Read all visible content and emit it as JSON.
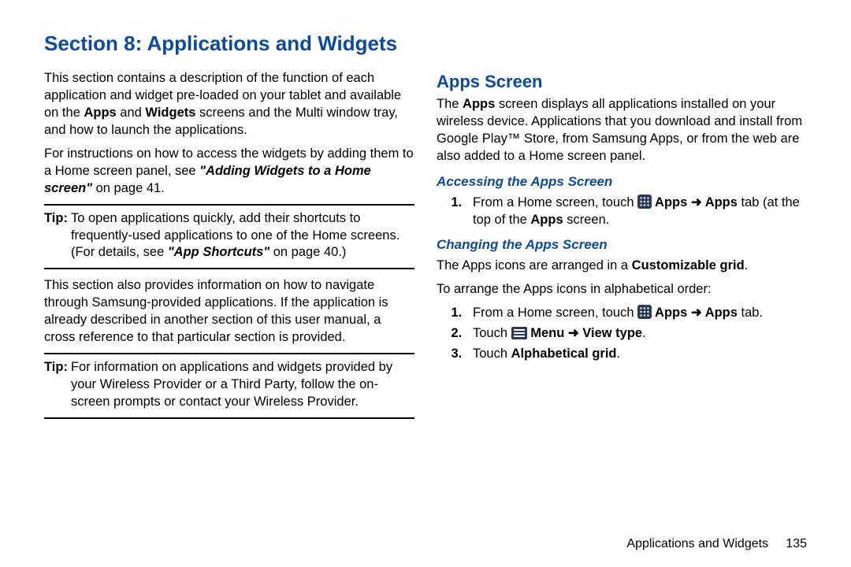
{
  "title": "Section 8: Applications and Widgets",
  "left": {
    "p1a": "This section contains a description of the function of each application and widget pre-loaded on your tablet and available on the ",
    "p1b_bold": "Apps",
    "p1c": " and ",
    "p1d_bold": "Widgets",
    "p1e": " screens and the Multi window tray, and how to launch the applications.",
    "p2a": "For instructions on how to access the widgets by adding them to a Home screen panel, see ",
    "p2b_link": "\"Adding Widgets to a Home screen\"",
    "p2c": " on page 41.",
    "tip1_label": "Tip:",
    "tip1a": " To open applications quickly, add their shortcuts to frequently-used applications to one of the Home screens. (For details, see ",
    "tip1b_link": "\"App Shortcuts\"",
    "tip1c": " on page 40.)",
    "p3": "This section also provides information on how to navigate through Samsung-provided applications. If the application is already described in another section of this user manual, a cross reference to that particular section is provided.",
    "tip2_label": "Tip:",
    "tip2": " For information on applications and widgets provided by your Wireless Provider or a Third Party, follow the on-screen prompts or contact your Wireless Provider."
  },
  "right": {
    "h2": "Apps Screen",
    "intro_a": "The ",
    "intro_b_bold": "Apps",
    "intro_c": " screen displays all applications installed on your wireless device. Applications that you download and install from Google Play™ Store, from Samsung Apps, or from the web are also added to a Home screen panel.",
    "h3a": "Accessing the Apps Screen",
    "a1_pre": "From a Home screen, touch ",
    "a1_apps": " Apps ",
    "a1_apps_tab": " Apps",
    "a1_post1": " tab (at the top of the ",
    "a1_post_apps": "Apps",
    "a1_post2": " screen.",
    "h3b": "Changing the Apps Screen",
    "b_line1_a": "The Apps icons are arranged in a ",
    "b_line1_b": "Customizable grid",
    "b_line1_c": ".",
    "b_line2": "To arrange the Apps icons in alphabetical order:",
    "b1_pre": "From a Home screen, touch ",
    "b1_apps": " Apps ",
    "b1_apps_tab": " Apps",
    "b1_post": " tab.",
    "b2_pre": "Touch ",
    "b2_menu": " Menu ",
    "b2_view": " View type",
    "b2_post": ".",
    "b3_pre": "Touch ",
    "b3_bold": "Alphabetical grid",
    "b3_post": "."
  },
  "footer": {
    "label": "Applications and Widgets",
    "page": "135"
  },
  "arrow": "➜"
}
